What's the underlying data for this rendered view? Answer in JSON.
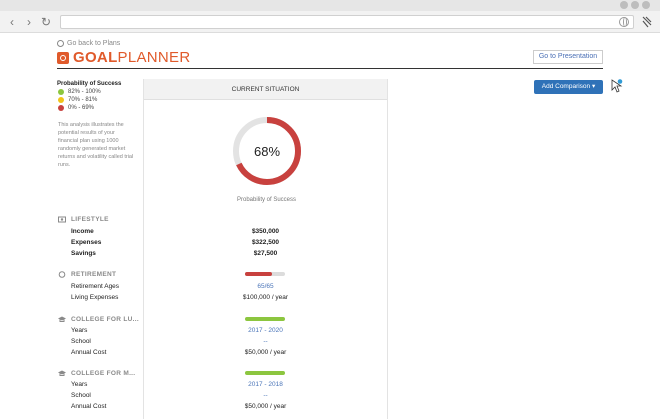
{
  "browser": {
    "url": ""
  },
  "header": {
    "back_label": "Go back to Plans",
    "logo_bold": "GOAL",
    "logo_light": "PLANNER",
    "presentation_button": "Go to Presentation",
    "comparison_button": "Add Comparison ▾"
  },
  "legend": {
    "title": "Probability of Success",
    "items": [
      {
        "label": "82% - 100%",
        "color": "#8cc63f"
      },
      {
        "label": "70% - 81%",
        "color": "#f0c419"
      },
      {
        "label": "0% - 69%",
        "color": "#c8413e"
      }
    ],
    "description": "This analysis illustrates the potential results of your financial plan using 1000 randomly generated market returns and volatility called trial runs."
  },
  "card": {
    "title": "CURRENT SITUATION",
    "probability": "68%",
    "probability_value": 68,
    "probability_caption": "Probability of Success",
    "gauge_color": "#c8413e",
    "gauge_track_color": "#e3e3e3"
  },
  "sections": {
    "lifestyle": {
      "title": "LIFESTYLE",
      "income_label": "Income",
      "income_value": "$350,000",
      "expenses_label": "Expenses",
      "expenses_value": "$322,500",
      "savings_label": "Savings",
      "savings_value": "$27,500"
    },
    "retirement": {
      "title": "RETIREMENT",
      "ages_label": "Retirement Ages",
      "ages_value": "65/65",
      "living_label": "Living Expenses",
      "living_value": "$100,000 / year"
    },
    "college1": {
      "title": "COLLEGE FOR LU...",
      "years_label": "Years",
      "years_value": "2017 - 2020",
      "school_label": "School",
      "school_value": "--",
      "cost_label": "Annual Cost",
      "cost_value": "$50,000 / year"
    },
    "college2": {
      "title": "COLLEGE FOR M...",
      "years_label": "Years",
      "years_value": "2017 - 2018",
      "school_label": "School",
      "school_value": "--",
      "cost_label": "Annual Cost",
      "cost_value": "$50,000 / year"
    }
  }
}
